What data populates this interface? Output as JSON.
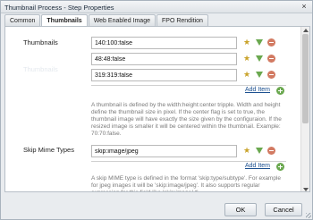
{
  "window": {
    "title": "Thumbnail Process - Step Properties",
    "close_glyph": "×"
  },
  "tabs": [
    {
      "label": "Common",
      "active": false
    },
    {
      "label": "Thumbnails",
      "active": true
    },
    {
      "label": "Web Enabled Image",
      "active": false
    },
    {
      "label": "FPO Rendition",
      "active": false
    }
  ],
  "thumbnails": {
    "label": "Thumbnails",
    "ghost_label": "Thumbnails",
    "items": [
      "140:100:false",
      "48:48:false",
      "319:319:false"
    ],
    "add_label": "Add Item",
    "help": "A thumbnail is defined by the width:height:center tripple. Width and height define the thumbnail size in pixel. If the center flag is set to true, the thumbnail image will have exactly the size given by the configuraion. If the resized image is smaller it will be centered within the thumbnail. Example: 70:70:false."
  },
  "skip_mime": {
    "label": "Skip Mime Types",
    "items": [
      "skip:image/jpeg"
    ],
    "add_label": "Add Item",
    "help": "A skip MIME type is defined in the format 'skip:type/subtype'. For example for jpeg images it will be 'skip:image/jpeg'. It also supports regular expression for this field like 'skip:image/.*'."
  },
  "icons": {
    "move_up": "star-icon",
    "move_down": "arrow-down-icon",
    "remove": "minus-icon",
    "add": "plus-icon"
  },
  "footer": {
    "ok_label": "OK",
    "cancel_label": "Cancel"
  }
}
